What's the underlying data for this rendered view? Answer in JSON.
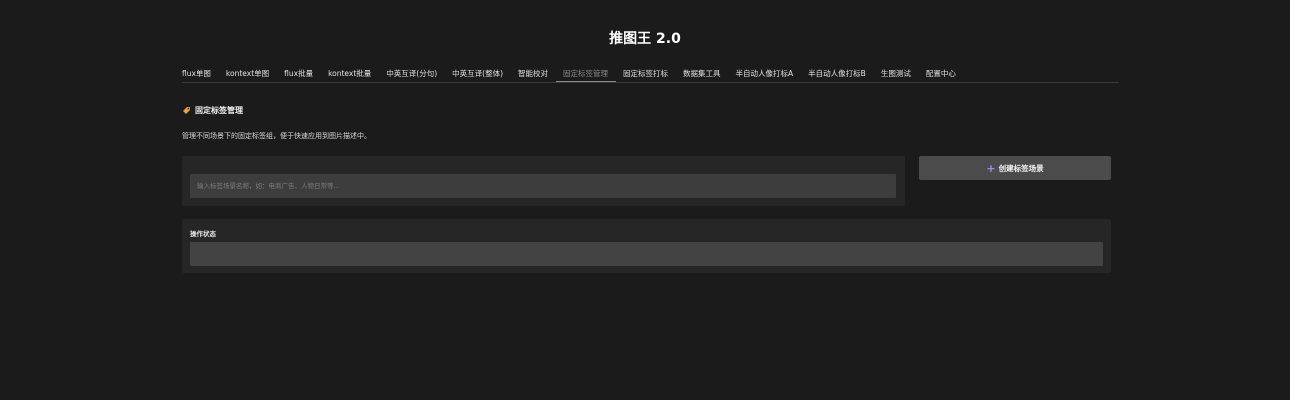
{
  "app": {
    "title": "推图王 2.0"
  },
  "tabs": [
    {
      "label": "flux单图",
      "active": false
    },
    {
      "label": "kontext单图",
      "active": false
    },
    {
      "label": "flux批量",
      "active": false
    },
    {
      "label": "kontext批量",
      "active": false
    },
    {
      "label": "中英互译(分句)",
      "active": false
    },
    {
      "label": "中英互译(整体)",
      "active": false
    },
    {
      "label": "智能校对",
      "active": false
    },
    {
      "label": "固定标签管理",
      "active": true
    },
    {
      "label": "固定标签打标",
      "active": false
    },
    {
      "label": "数据集工具",
      "active": false
    },
    {
      "label": "半自动人像打标A",
      "active": false
    },
    {
      "label": "半自动人像打标B",
      "active": false
    },
    {
      "label": "生图测试",
      "active": false
    },
    {
      "label": "配置中心",
      "active": false
    }
  ],
  "section": {
    "title": "固定标签管理",
    "icon": "tag-icon",
    "description": "管理不同场景下的固定标签组，便于快速应用到图片描述中。"
  },
  "scene_input": {
    "placeholder": "输入标签场景名称，如：电商广告、人物日常等...",
    "value": ""
  },
  "create_button": {
    "label": "创建标签场景",
    "icon": "plus-icon"
  },
  "status": {
    "label": "操作状态",
    "value": ""
  },
  "colors": {
    "background": "#1b1b1b",
    "panel": "#262626",
    "input": "#3d3d3d",
    "button": "#4b4b4b",
    "accent": "#9d8fe6",
    "tag_icon": "#e8a33c"
  }
}
